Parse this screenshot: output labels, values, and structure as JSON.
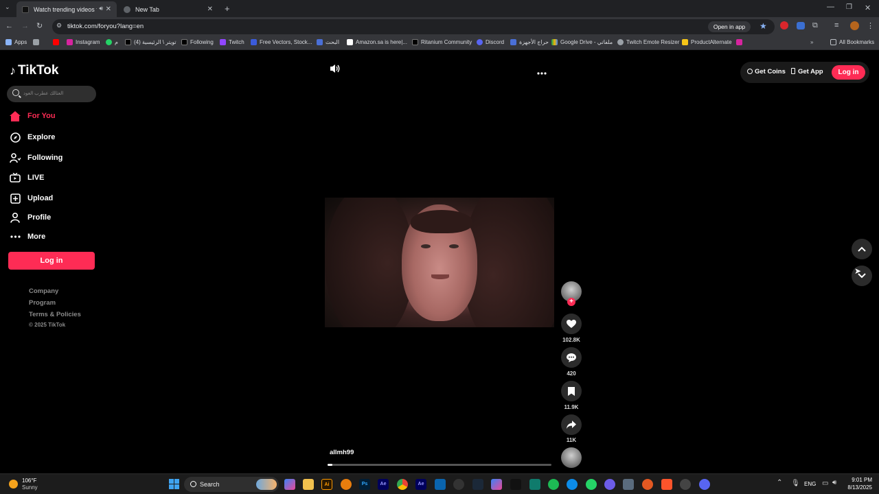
{
  "browser": {
    "tabs": [
      {
        "title": "Watch trending videos for y",
        "active": true
      },
      {
        "title": "New Tab",
        "active": false
      }
    ],
    "url": "tiktok.com/foryou?lang=en",
    "open_in_app": "Open in app",
    "bookmarks": [
      "Apps",
      "Instagram",
      "م",
      "تويتر \\ الرئيسية (4)",
      "Following",
      "Twitch",
      "Free Vectors, Stock...",
      "البحث",
      "Amazon.sa is here|...",
      "Ritanium Community",
      "Discord",
      "حراج الأجهزة",
      "Google Drive - ملفاتي",
      "Twitch Emote Resizer",
      "ProductAlternate"
    ],
    "all_bookmarks": "All Bookmarks"
  },
  "tiktok": {
    "logo": "TikTok",
    "search_placeholder": "العثالك عطرب العود",
    "nav": [
      "For You",
      "Explore",
      "Following",
      "LIVE",
      "Upload",
      "Profile",
      "More"
    ],
    "login_side": "Log in",
    "footer": [
      "Company",
      "Program",
      "Terms & Policies",
      "© 2025 TikTok"
    ],
    "get_coins": "Get Coins",
    "get_app": "Get App",
    "login_top": "Log in",
    "username": "allmh99",
    "likes": "102.8K",
    "comments": "420",
    "saves": "11.9K",
    "shares": "11K",
    "progress": 0.02
  },
  "taskbar": {
    "temp": "106°F",
    "weather": "Sunny",
    "search_label": "Search",
    "lang": "ENG",
    "time": "9:01 PM",
    "date": "8/13/2025"
  },
  "colors": {
    "brand": "#fe2c55",
    "chrome_dark": "#202124",
    "chrome": "#35363a"
  }
}
